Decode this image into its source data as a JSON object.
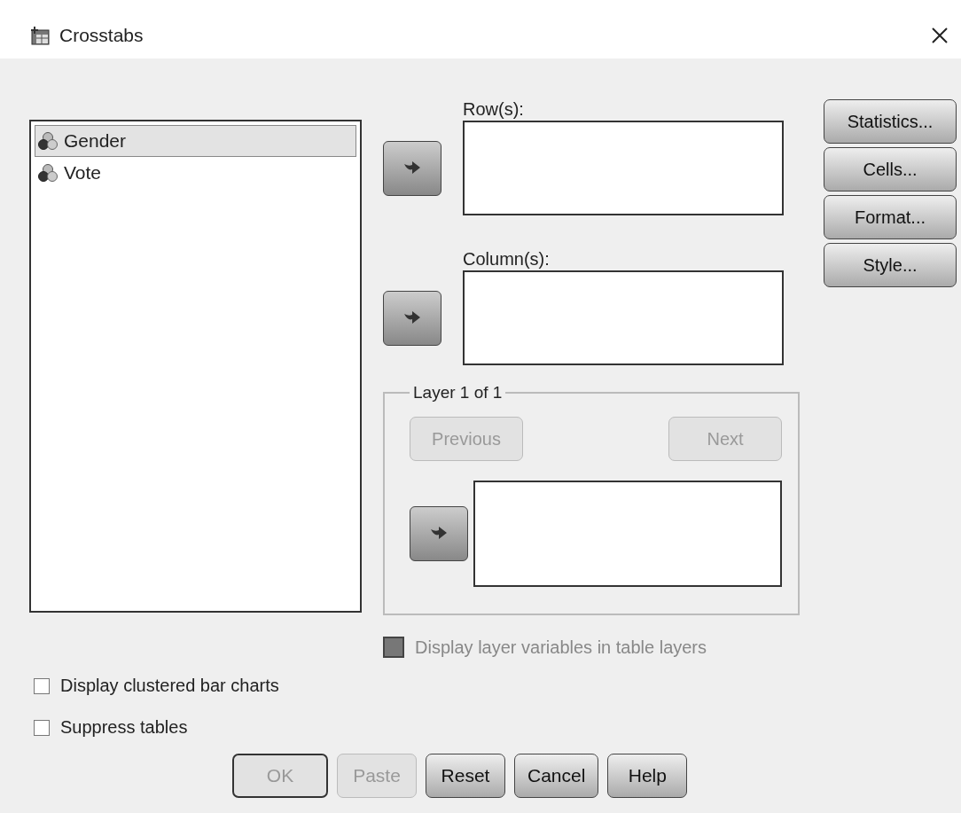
{
  "window": {
    "title": "Crosstabs"
  },
  "variables": [
    {
      "name": "Gender",
      "selected": true
    },
    {
      "name": "Vote",
      "selected": false
    }
  ],
  "rows": {
    "label": "Row(s):"
  },
  "columns": {
    "label": "Column(s):"
  },
  "layer": {
    "title": "Layer 1 of 1",
    "previous": {
      "label": "Previous",
      "disabled": true
    },
    "next": {
      "label": "Next",
      "disabled": true
    }
  },
  "display_layer_variables": {
    "label": "Display layer variables in table layers",
    "disabled": true
  },
  "side_buttons": [
    "Statistics...",
    "Cells...",
    "Format...",
    "Style..."
  ],
  "options": [
    {
      "label": "Display clustered bar charts",
      "checked": false
    },
    {
      "label": "Suppress tables",
      "checked": false
    }
  ],
  "buttons": [
    {
      "label": "OK",
      "disabled": true
    },
    {
      "label": "Paste",
      "disabled": true
    },
    {
      "label": "Reset",
      "disabled": false
    },
    {
      "label": "Cancel",
      "disabled": false
    },
    {
      "label": "Help",
      "disabled": false
    }
  ]
}
